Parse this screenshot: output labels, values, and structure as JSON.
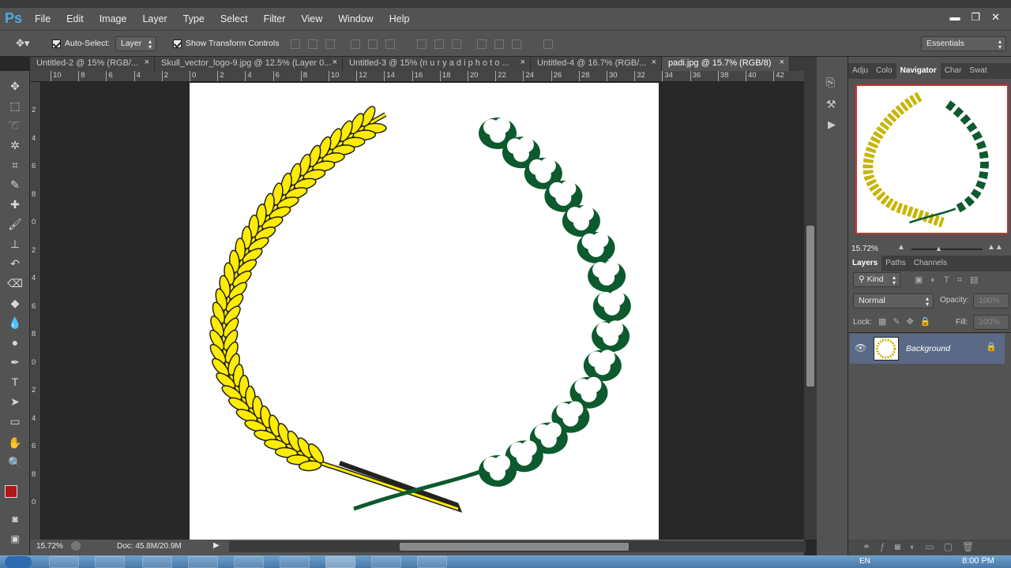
{
  "app": {
    "logo": "Ps"
  },
  "menubar": {
    "items": [
      "File",
      "Edit",
      "Image",
      "Layer",
      "Type",
      "Select",
      "Filter",
      "View",
      "Window",
      "Help"
    ]
  },
  "optionsbar": {
    "auto_select_label": "Auto-Select:",
    "auto_select_value": "Layer",
    "show_transform_label": "Show Transform Controls",
    "workspace": "Essentials"
  },
  "tabs": [
    {
      "label": "Untitled-2 @ 15% (RGB/..."
    },
    {
      "label": "Skull_vector_logo-9.jpg @ 12.5% (Layer 0..."
    },
    {
      "label": "Untitled-3 @ 15% (n u r y a d i  p h o t o ..."
    },
    {
      "label": "Untitled-4 @ 16.7% (RGB/..."
    },
    {
      "label": "padi.jpg @ 15.7% (RGB/8)"
    }
  ],
  "ruler_h": [
    "10",
    "8",
    "6",
    "4",
    "2",
    "0",
    "2",
    "4",
    "6",
    "8",
    "10",
    "12",
    "14",
    "16",
    "18",
    "20",
    "22",
    "24",
    "26",
    "28",
    "30",
    "32",
    "34",
    "36",
    "38",
    "40",
    "42"
  ],
  "ruler_v": [
    "2",
    "4",
    "6",
    "8",
    "0",
    "2",
    "4",
    "6",
    "8",
    "0",
    "2",
    "4",
    "6",
    "8",
    "0"
  ],
  "status": {
    "zoom": "15.72%",
    "doc": "Doc: 45.8M/20.9M"
  },
  "panels": {
    "top_tabs": [
      "Adju",
      "Colo",
      "Navigator",
      "Char",
      "Swat"
    ],
    "navigator_zoom": "15.72%",
    "layer_tabs": [
      "Layers",
      "Paths",
      "Channels"
    ],
    "kind_label": "Kind",
    "blend_mode": "Normal",
    "opacity_label": "Opacity:",
    "opacity_value": "100%",
    "lock_label": "Lock:",
    "fill_label": "Fill:",
    "fill_value": "100%",
    "layer_name": "Background"
  },
  "taskbar": {
    "lang": "EN",
    "time": "8:00 PM"
  },
  "colors": {
    "foreground": "#b01818",
    "background": "#ffffff",
    "wheat": "#ffec00",
    "cotton": "#0c5a2e"
  }
}
